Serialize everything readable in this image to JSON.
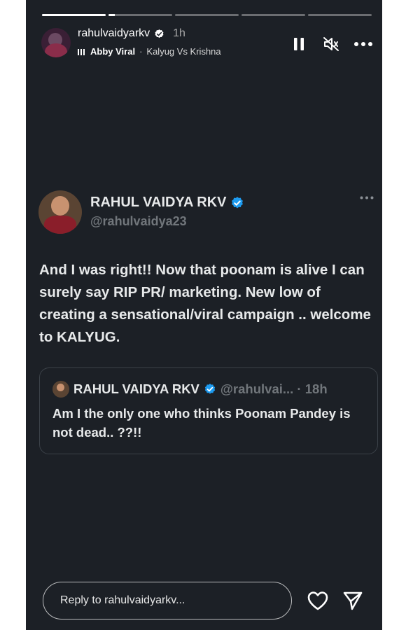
{
  "story": {
    "progress": [
      1,
      0.1,
      0,
      0,
      0
    ],
    "username": "rahulvaidyarkv",
    "time": "1h",
    "music": {
      "artist": "Abby Viral",
      "separator": "·",
      "song": "Kalyug Vs Krishna"
    },
    "controls": {
      "pause_icon": "pause-icon",
      "mute_icon": "speaker-muted-icon",
      "more_icon": "more-horizontal-icon"
    }
  },
  "tweet": {
    "name": "RAHUL VAIDYA RKV",
    "handle": "@rahulvaidya23",
    "text": "And I was right!! Now that poonam is alive I can surely say RIP PR/ marketing. New low of creating a sensational/viral campaign .. welcome to KALYUG.",
    "quote": {
      "name": "RAHUL VAIDYA RKV",
      "handle_time": "@rahulvai... · 18h",
      "text": "Am I the only one who thinks Poonam Pandey is not dead.. ??!!"
    }
  },
  "reply": {
    "placeholder": "Reply to rahulvaidyarkv..."
  },
  "colors": {
    "story_bg": "#1c2026",
    "verified": "#1d9bf0",
    "handle": "#71767b"
  }
}
